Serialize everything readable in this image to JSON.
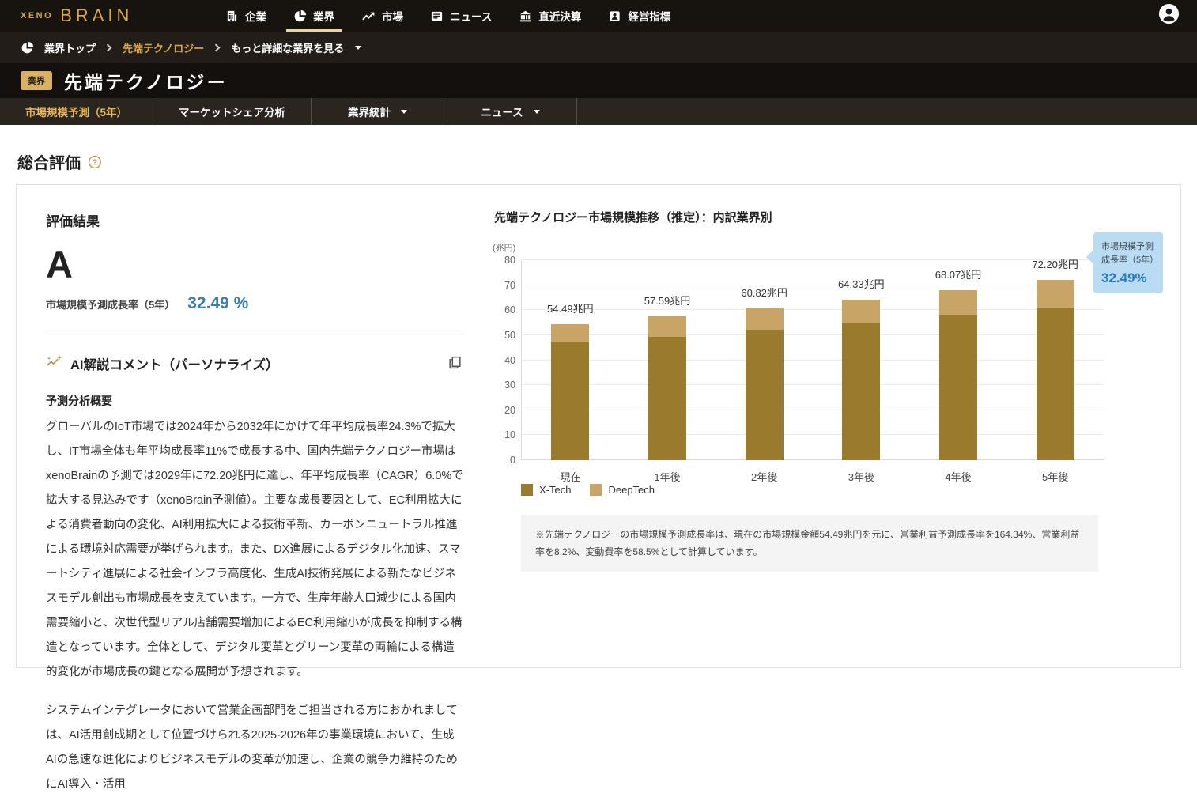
{
  "brand": {
    "xeno": "XENO",
    "brain": "BRAIN"
  },
  "topnav": {
    "items": [
      {
        "id": "companies",
        "label": "企業",
        "icon": "building-icon",
        "active": false
      },
      {
        "id": "industry",
        "label": "業界",
        "icon": "pie-chart-icon",
        "active": true
      },
      {
        "id": "market",
        "label": "市場",
        "icon": "trend-icon",
        "active": false
      },
      {
        "id": "news",
        "label": "ニュース",
        "icon": "news-icon",
        "active": false
      },
      {
        "id": "earnings",
        "label": "直近決算",
        "icon": "bank-icon",
        "active": false
      },
      {
        "id": "indicators",
        "label": "経営指標",
        "icon": "person-badge-icon",
        "active": false
      }
    ],
    "avatar_icon": "user-avatar-icon"
  },
  "breadcrumb": {
    "root": "業界トップ",
    "current": "先端テクノロジー",
    "more": "もっと詳細な業界を見る"
  },
  "page": {
    "badge": "業界",
    "title": "先端テクノロジー"
  },
  "tabs": [
    {
      "id": "forecast",
      "label": "市場規模予測（5年）",
      "active": true,
      "caret": false
    },
    {
      "id": "share",
      "label": "マーケットシェア分析",
      "active": false,
      "caret": false
    },
    {
      "id": "stats",
      "label": "業界統計",
      "active": false,
      "caret": true
    },
    {
      "id": "tab-news",
      "label": "ニュース",
      "active": false,
      "caret": true
    }
  ],
  "section": {
    "heading": "総合評価"
  },
  "evaluation": {
    "heading": "評価結果",
    "grade": "A",
    "growth_label": "市場規模予測成長率（5年）",
    "growth_value": "32.49 %",
    "ai_heading": "AI解説コメント（パーソナライズ）",
    "summary_heading": "予測分析概要",
    "paragraph1": "グローバルのIoT市場では2024年から2032年にかけて年平均成長率24.3%で拡大し、IT市場全体も年平均成長率11%で成長する中、国内先端テクノロジー市場はxenoBrainの予測では2029年に72.20兆円に達し、年平均成長率（CAGR）6.0%で拡大する見込みです（xenoBrain予測値）。主要な成長要因として、EC利用拡大による消費者動向の変化、AI利用拡大による技術革新、カーボンニュートラル推進による環境対応需要が挙げられます。また、DX進展によるデジタル化加速、スマートシティ進展による社会インフラ高度化、生成AI技術発展による新たなビジネスモデル創出も市場成長を支えています。一方で、生産年齢人口減少による国内需要縮小と、次世代型リアル店舗需要増加によるEC利用縮小が成長を抑制する構造となっています。全体として、デジタル変革とグリーン変革の両輪による構造的変化が市場成長の鍵となる展開が予想されます。",
    "paragraph2": "システムインテグレータにおいて営業企画部門をご担当される方におかれましては、AI活用創成期として位置づけられる2025-2026年の事業環境において、生成AIの急速な進化によりビジネスモデルの変革が加速し、企業の競争力維持のためにAI導入・活用"
  },
  "chart_data": {
    "type": "bar",
    "stacked": true,
    "title": "先端テクノロジー市場規模推移（推定）：内訳業界別",
    "unit_label": "(兆円)",
    "categories": [
      "現在",
      "1年後",
      "2年後",
      "3年後",
      "4年後",
      "5年後"
    ],
    "series": [
      {
        "name": "X-Tech",
        "color": "#9a7a2c",
        "values": [
          47.0,
          49.4,
          52.3,
          54.9,
          57.9,
          61.0
        ]
      },
      {
        "name": "DeepTech",
        "color": "#c8a567",
        "values": [
          7.49,
          8.19,
          8.52,
          9.43,
          10.17,
          11.2
        ]
      }
    ],
    "totals": [
      54.49,
      57.59,
      60.82,
      64.33,
      68.07,
      72.2
    ],
    "total_labels": [
      "54.49兆円",
      "57.59兆円",
      "60.82兆円",
      "64.33兆円",
      "68.07兆円",
      "72.20兆円"
    ],
    "ylim": [
      0,
      80
    ],
    "yticks": [
      0,
      10,
      20,
      30,
      40,
      50,
      60,
      70,
      80
    ],
    "grid": true,
    "legend_position": "bottom"
  },
  "callout": {
    "label": "市場規模予測成長率（5年）",
    "value": "32.49%"
  },
  "footnote": "※先端テクノロジーの市場規模予測成長率は、現在の市場規模金額54.49兆円を元に、営業利益予測成長率を164.34%、営業利益率を8.2%、変動費率を58.5%として計算しています。"
}
